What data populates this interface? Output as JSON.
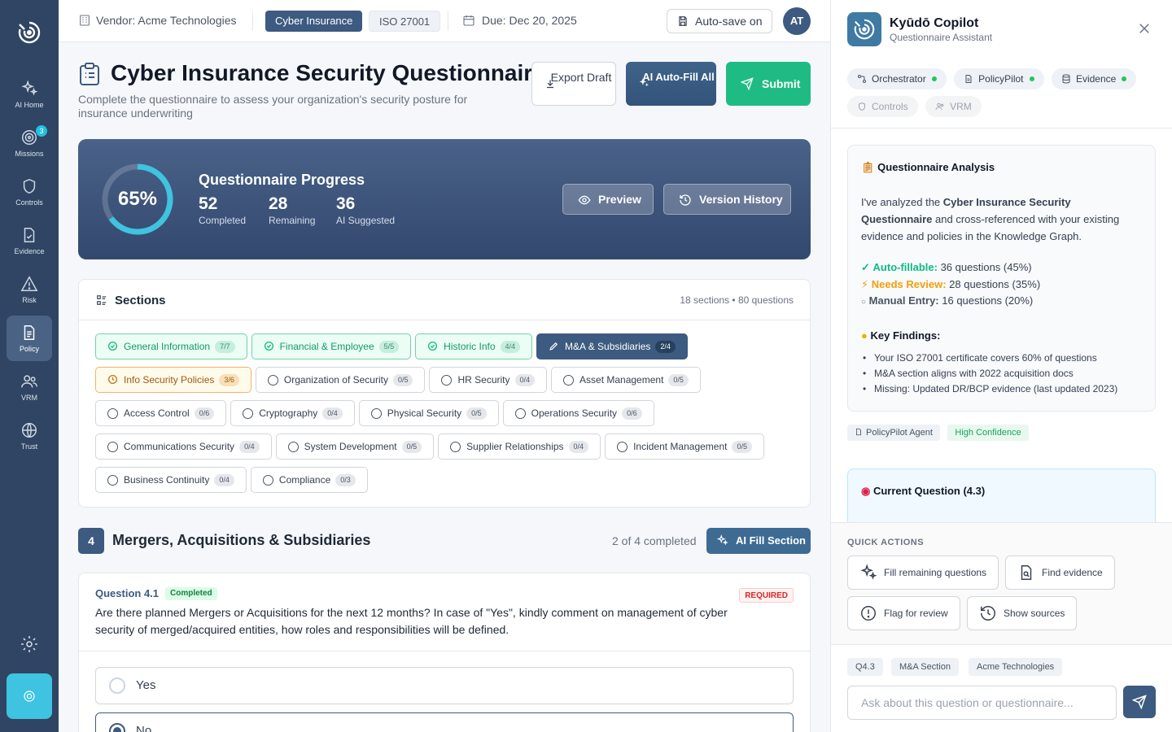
{
  "nav": {
    "items": [
      {
        "label": "AI Home"
      },
      {
        "label": "Missions",
        "badge": "3"
      },
      {
        "label": "Controls"
      },
      {
        "label": "Evidence"
      },
      {
        "label": "Risk"
      },
      {
        "label": "Policy"
      },
      {
        "label": "VRM"
      },
      {
        "label": "Trust"
      }
    ],
    "active": "Policy"
  },
  "topbar": {
    "vendor": "Vendor: Acme Technologies",
    "framework_active": "Cyber Insurance",
    "framework_other": "ISO 27001",
    "due": "Due: Dec 20, 2025",
    "autosave": "Auto-save on",
    "avatar": "AT"
  },
  "page": {
    "title": "Cyber Insurance Security Questionnaire",
    "subtitle": "Complete the questionnaire to assess your organization's security posture for insurance underwriting",
    "export_label": "Export Draft",
    "ai_autofill_label": "AI Auto-Fill All",
    "submit_label": "Submit"
  },
  "progress": {
    "percent_label": "65%",
    "percent": 0.65,
    "title": "Questionnaire Progress",
    "completed": "52",
    "completed_label": "Completed",
    "remaining": "28",
    "remaining_label": "Remaining",
    "suggested": "36",
    "suggested_label": "AI Suggested",
    "preview_label": "Preview",
    "version_label": "Version History"
  },
  "sections": {
    "title": "Sections",
    "meta": "18 sections • 80 questions",
    "items": [
      {
        "label": "General Information",
        "count": "7/7",
        "state": "done"
      },
      {
        "label": "Financial & Employee",
        "count": "5/5",
        "state": "done"
      },
      {
        "label": "Historic Info",
        "count": "4/4",
        "state": "done"
      },
      {
        "label": "M&A & Subsidiaries",
        "count": "2/4",
        "state": "current"
      },
      {
        "label": "Info Security Policies",
        "count": "3/6",
        "state": "partial"
      },
      {
        "label": "Organization of Security",
        "count": "0/5",
        "state": "todo"
      },
      {
        "label": "HR Security",
        "count": "0/4",
        "state": "todo"
      },
      {
        "label": "Asset Management",
        "count": "0/5",
        "state": "todo"
      },
      {
        "label": "Access Control",
        "count": "0/6",
        "state": "todo"
      },
      {
        "label": "Cryptography",
        "count": "0/4",
        "state": "todo"
      },
      {
        "label": "Physical Security",
        "count": "0/5",
        "state": "todo"
      },
      {
        "label": "Operations Security",
        "count": "0/6",
        "state": "todo"
      },
      {
        "label": "Communications Security",
        "count": "0/4",
        "state": "todo"
      },
      {
        "label": "System Development",
        "count": "0/5",
        "state": "todo"
      },
      {
        "label": "Supplier Relationships",
        "count": "0/4",
        "state": "todo"
      },
      {
        "label": "Incident Management",
        "count": "0/5",
        "state": "todo"
      },
      {
        "label": "Business Continuity",
        "count": "0/4",
        "state": "todo"
      },
      {
        "label": "Compliance",
        "count": "0/3",
        "state": "todo"
      }
    ]
  },
  "current_section": {
    "number": "4",
    "title": "Mergers, Acquisitions & Subsidiaries",
    "count": "2 of 4 completed",
    "fill_label": "AI Fill Section"
  },
  "question": {
    "number": "Question 4.1",
    "status": "Completed",
    "required": "REQUIRED",
    "text": "Are there planned Mergers or Acquisitions for the next 12 months? In case of \"Yes\", kindly comment on management of cyber security of merged/acquired entities, how roles and responsibilities will be defined.",
    "options": [
      {
        "label": "Yes",
        "selected": false
      },
      {
        "label": "No",
        "selected": true
      }
    ]
  },
  "copilot": {
    "title": "Kyūdō Copilot",
    "subtitle": "Questionnaire Assistant",
    "agents": [
      {
        "label": "Orchestrator",
        "active": true
      },
      {
        "label": "PolicyPilot",
        "active": true
      },
      {
        "label": "Evidence",
        "active": true
      },
      {
        "label": "Controls",
        "active": false
      },
      {
        "label": "VRM",
        "active": false
      }
    ],
    "analysis": {
      "title": "Questionnaire Analysis",
      "intro_pre": "I've analyzed the ",
      "intro_bold": "Cyber Insurance Security Questionnaire",
      "intro_post": " and cross-referenced with your existing evidence and policies in the Knowledge Graph.",
      "auto_label": "Auto-fillable:",
      "auto_value": " 36 questions (45%)",
      "review_label": "Needs Review:",
      "review_value": " 28 questions (35%)",
      "manual_label": "Manual Entry:",
      "manual_value": " 16 questions (20%)",
      "findings_title": "Key Findings:",
      "findings": [
        "Your ISO 27001 certificate covers 60% of questions",
        "M&A section aligns with 2022 acquisition docs",
        "Missing: Updated DR/BCP evidence (last updated 2023)"
      ]
    },
    "source_agent": "PolicyPilot Agent",
    "confidence": "High Confidence",
    "current_question_title": "Current Question (4.3)",
    "quick_actions_title": "QUICK ACTIONS",
    "quick_actions": [
      "Fill remaining questions",
      "Find evidence",
      "Flag for review",
      "Show sources"
    ],
    "context_tags": [
      "Q4.3",
      "M&A Section",
      "Acme Technologies"
    ],
    "input_placeholder": "Ask about this question or questionnaire..."
  },
  "colors": {
    "rail": "#2f4563",
    "primary": "#3d5a80",
    "success": "#1ebc84",
    "accent": "#3ec3e0",
    "warning": "#f59e0b"
  }
}
